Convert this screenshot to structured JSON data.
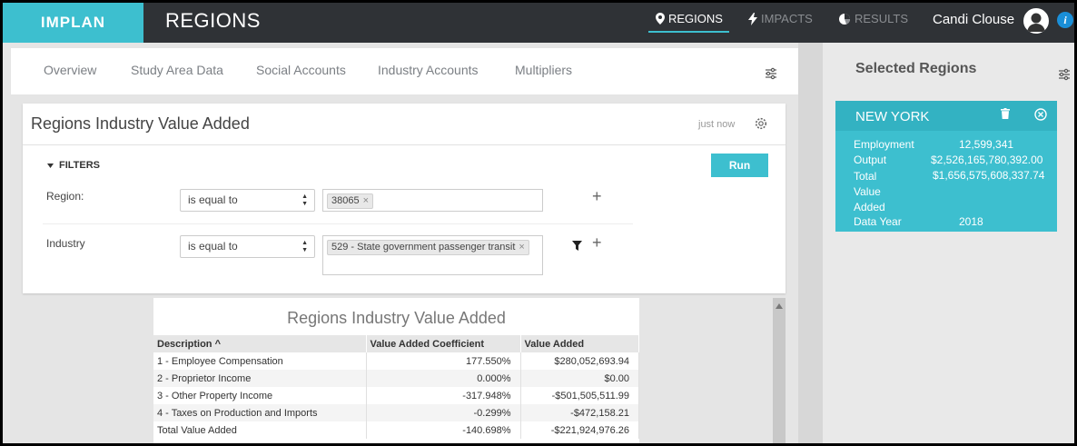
{
  "header": {
    "logo": "IMPLAN",
    "title": "REGIONS",
    "nav": [
      {
        "label": "REGIONS",
        "icon": "map-pin-icon",
        "active": true
      },
      {
        "label": "IMPACTS",
        "icon": "lightning-icon",
        "active": false
      },
      {
        "label": "RESULTS",
        "icon": "pie-chart-icon",
        "active": false
      }
    ],
    "user_name": "Candi Clouse",
    "info_glyph": "i"
  },
  "tabs": [
    "Overview",
    "Study Area Data",
    "Social Accounts",
    "Industry Accounts",
    "Multipliers"
  ],
  "report": {
    "title": "Regions Industry Value Added",
    "timestamp": "just now",
    "filters_label": "FILTERS",
    "run_label": "Run",
    "filters": [
      {
        "label": "Region:",
        "operator": "is equal to",
        "tags": [
          "38065"
        ]
      },
      {
        "label": "Industry",
        "operator": "is equal to",
        "tags": [
          "529 - State government passenger transit"
        ]
      }
    ]
  },
  "table": {
    "title": "Regions Industry Value Added",
    "columns": [
      "Description",
      "Value Added Coefficient",
      "Value Added"
    ],
    "sort_glyph": "^",
    "rows": [
      [
        "1 - Employee Compensation",
        "177.550%",
        "$280,052,693.94"
      ],
      [
        "2 - Proprietor Income",
        "0.000%",
        "$0.00"
      ],
      [
        "3 - Other Property Income",
        "-317.948%",
        "-$501,505,511.99"
      ],
      [
        "4 - Taxes on Production and Imports",
        "-0.299%",
        "-$472,158.21"
      ],
      [
        "Total Value Added",
        "-140.698%",
        "-$221,924,976.26"
      ]
    ]
  },
  "selected_regions": {
    "title": "Selected Regions",
    "region": {
      "name": "NEW YORK",
      "stats": [
        {
          "label": "Employment",
          "value": "12,599,341"
        },
        {
          "label": "Output",
          "value": "$2,526,165,780,392.00"
        },
        {
          "label": "Total Value Added",
          "value": "$1,656,575,608,337.74"
        },
        {
          "label": "Data Year",
          "value": "2018"
        }
      ]
    }
  },
  "colors": {
    "accent": "#3dbfcf",
    "topbar": "#2f3236"
  }
}
